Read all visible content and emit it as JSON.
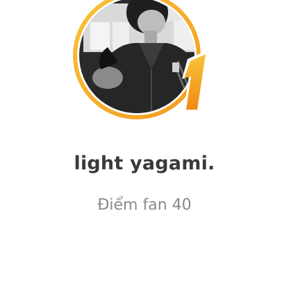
{
  "profile": {
    "username": "light yagami.",
    "fan_score_text": "Điểm fan 40",
    "rank_number": "1"
  },
  "colors": {
    "ring_gold": "#F5B623",
    "ring_orange": "#F39A1E",
    "text_dark": "#3A3A3A",
    "text_muted": "#8A8A8A"
  },
  "icons": {
    "rank_badge": "rank-1-badge-icon",
    "avatar": "user-avatar"
  }
}
